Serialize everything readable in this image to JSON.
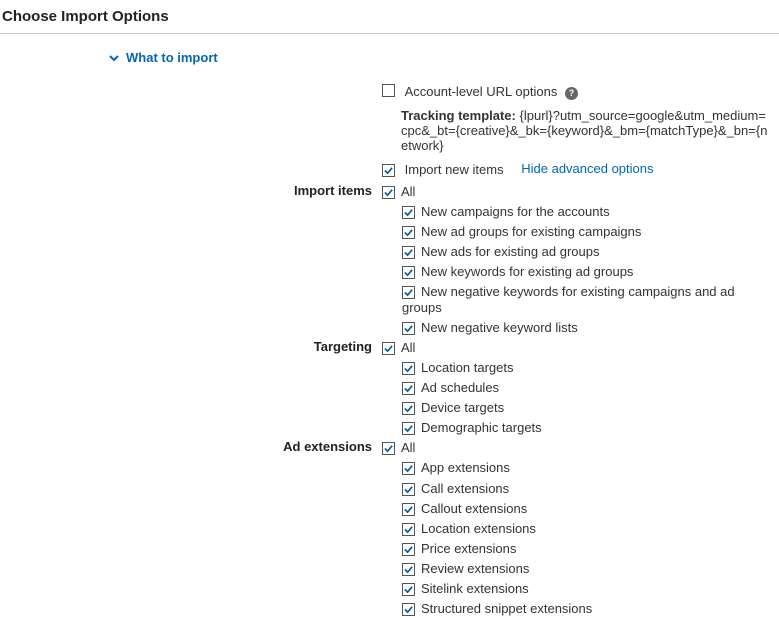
{
  "page_title": "Choose Import Options",
  "collapse_header": "What to import",
  "account_url": {
    "label": "Account-level URL options",
    "checked": false
  },
  "tracking": {
    "label": "Tracking template:",
    "value": "{lpurl}?utm_source=google&utm_medium=cpc&_bt={creative}&_bk={keyword}&_bm={matchType}&_bn={network}"
  },
  "import_new": {
    "label": "Import new items",
    "checked": true
  },
  "hide_advanced": "Hide advanced options",
  "groups": [
    {
      "header": "Import items",
      "all_label": "All",
      "all_checked": true,
      "items": [
        {
          "label": "New campaigns for the accounts",
          "checked": true
        },
        {
          "label": "New ad groups for existing campaigns",
          "checked": true
        },
        {
          "label": "New ads for existing ad groups",
          "checked": true
        },
        {
          "label": "New keywords for existing ad groups",
          "checked": true
        },
        {
          "label": "New negative keywords for existing campaigns and ad groups",
          "checked": true
        },
        {
          "label": "New negative keyword lists",
          "checked": true
        }
      ]
    },
    {
      "header": "Targeting",
      "all_label": "All",
      "all_checked": true,
      "items": [
        {
          "label": "Location targets",
          "checked": true
        },
        {
          "label": "Ad schedules",
          "checked": true
        },
        {
          "label": "Device targets",
          "checked": true
        },
        {
          "label": "Demographic targets",
          "checked": true
        }
      ]
    },
    {
      "header": "Ad extensions",
      "all_label": "All",
      "all_checked": true,
      "items": [
        {
          "label": "App extensions",
          "checked": true
        },
        {
          "label": "Call extensions",
          "checked": true
        },
        {
          "label": "Callout extensions",
          "checked": true
        },
        {
          "label": "Location extensions",
          "checked": true
        },
        {
          "label": "Price extensions",
          "checked": true
        },
        {
          "label": "Review extensions",
          "checked": true
        },
        {
          "label": "Sitelink extensions",
          "checked": true
        },
        {
          "label": "Structured snippet extensions",
          "checked": true
        }
      ]
    }
  ]
}
